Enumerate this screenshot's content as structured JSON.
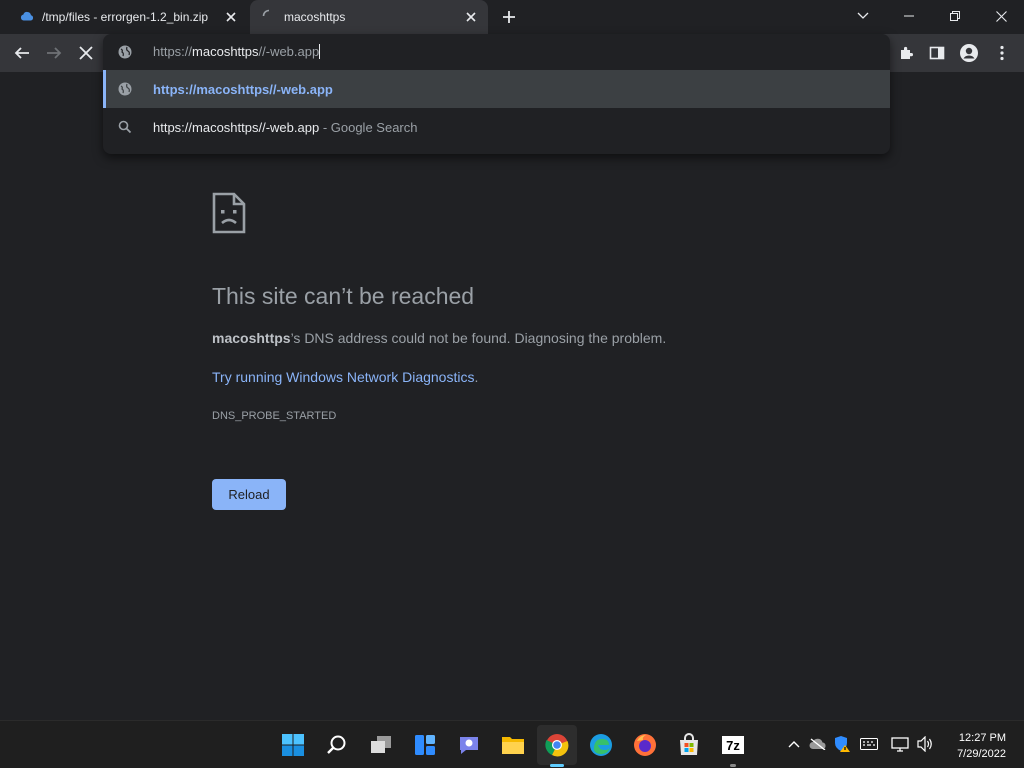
{
  "tabs": [
    {
      "title": "/tmp/files - errorgen-1.2_bin.zip",
      "active": false
    },
    {
      "title": "macoshttps",
      "active": true
    }
  ],
  "omnibox": {
    "scheme": "https://",
    "host": "macoshttps",
    "rest": "//-web.app",
    "suggestions": [
      {
        "text": "https://macoshttps//-web.app",
        "sub": "",
        "icon": "globe-icon"
      },
      {
        "text": "https://macoshttps//-web.app",
        "sub": " - Google Search",
        "icon": "search-icon"
      }
    ]
  },
  "error_page": {
    "title": "This site can’t be reached",
    "host_bold": "macoshttps",
    "message": "’s DNS address could not be found. Diagnosing the problem.",
    "link_text": "Try running Windows Network Diagnostics",
    "link_suffix": ".",
    "error_code": "DNS_PROBE_STARTED",
    "reload_label": "Reload"
  },
  "taskbar": {
    "apps": [
      "start",
      "search",
      "task-view",
      "widgets",
      "chat",
      "file-explorer",
      "chrome",
      "edge",
      "firefox",
      "store",
      "7zip"
    ],
    "active_app": "chrome",
    "time": "12:27 PM",
    "date": "7/29/2022"
  },
  "colors": {
    "page_bg": "#202124",
    "toolbar_bg": "#35363a",
    "accent_link": "#8ab4f8",
    "taskbar_bg": "#1f1f1f"
  }
}
